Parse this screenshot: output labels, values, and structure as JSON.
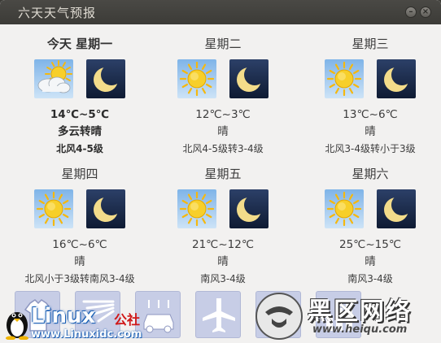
{
  "window": {
    "title": "六天天气预报",
    "controls": [
      "minimize-icon",
      "close-icon"
    ]
  },
  "days": [
    {
      "name": "今天  星期一",
      "day_icon": "partly-cloudy-icon",
      "night_icon": "crescent-moon-icon",
      "temp": "14℃~5℃",
      "condition": "多云转晴",
      "wind": "北风4-5级"
    },
    {
      "name": "星期二",
      "day_icon": "sun-icon",
      "night_icon": "crescent-moon-icon",
      "temp": "12℃~3℃",
      "condition": "晴",
      "wind": "北风4-5级转3-4级"
    },
    {
      "name": "星期三",
      "day_icon": "sun-icon",
      "night_icon": "crescent-moon-icon",
      "temp": "13℃~6℃",
      "condition": "晴",
      "wind": "北风3-4级转小于3级"
    },
    {
      "name": "星期四",
      "day_icon": "sun-icon",
      "night_icon": "crescent-moon-icon",
      "temp": "16℃~6℃",
      "condition": "晴",
      "wind": "北风小于3级转南风3-4级"
    },
    {
      "name": "星期五",
      "day_icon": "sun-icon",
      "night_icon": "crescent-moon-icon",
      "temp": "21℃~12℃",
      "condition": "晴",
      "wind": "南风3-4级"
    },
    {
      "name": "星期六",
      "day_icon": "sun-icon",
      "night_icon": "crescent-moon-icon",
      "temp": "25℃~15℃",
      "condition": "晴",
      "wind": "南风3-4级"
    }
  ],
  "index_tiles": [
    "clothing-icon",
    "sun-rays-icon",
    "car-wash-icon",
    "airplane-icon",
    "umbrella-icon",
    "index-icon"
  ],
  "watermarks": {
    "linux": {
      "word": "Linux",
      "cn": "公社",
      "url": "www.Linuxidc.com"
    },
    "heiqu": {
      "word": "黑区网络",
      "url": "www.heiqu.com"
    }
  },
  "colors": {
    "titlebar": "#3c3b37",
    "window_bg": "#f2f1f0",
    "sky_day": "#a9cdef",
    "sky_night": "#1e2f4f",
    "sun": "#f5c21b",
    "tile_bg": "#c7cde6"
  }
}
